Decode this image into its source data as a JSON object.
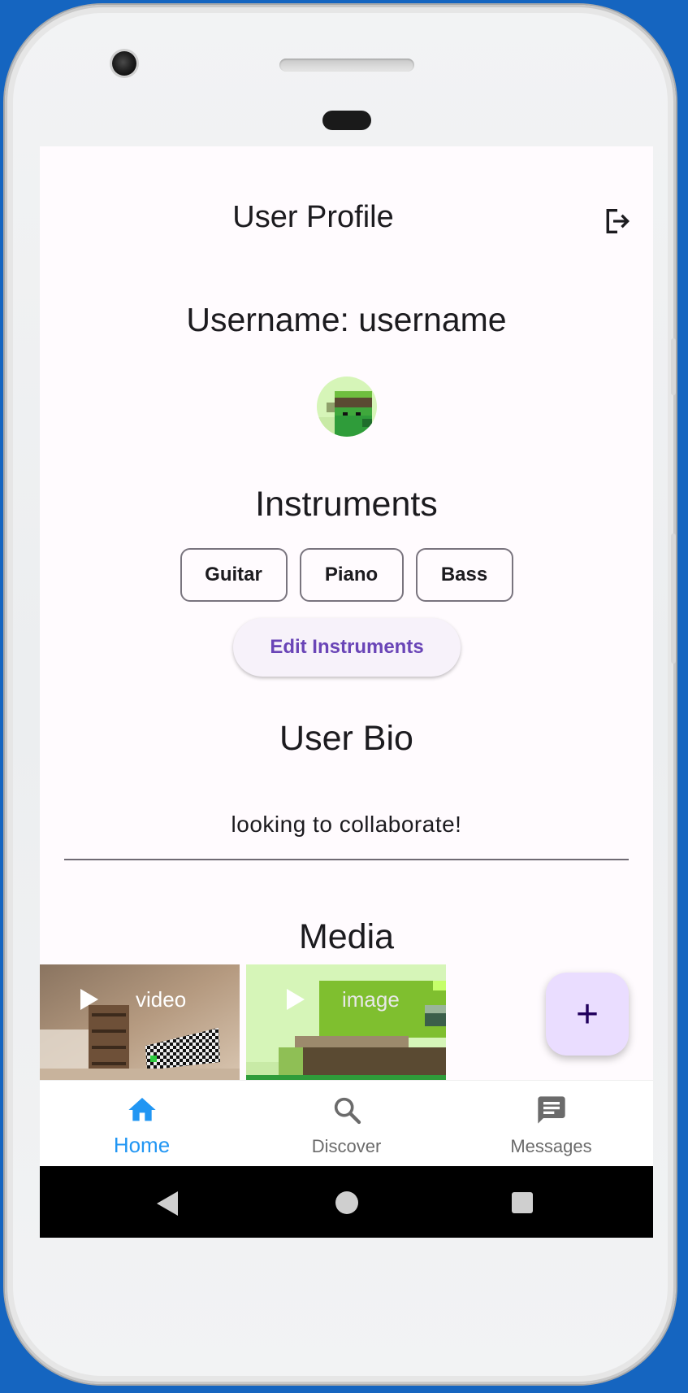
{
  "app_bar": {
    "title": "User Profile",
    "logout_icon": "logout-icon"
  },
  "profile": {
    "username_text": "Username: username",
    "avatar_icon": "pixel-avatar"
  },
  "instruments": {
    "heading": "Instruments",
    "chips": [
      "Guitar",
      "Piano",
      "Bass"
    ],
    "edit_button": "Edit Instruments"
  },
  "bio": {
    "heading": "User Bio",
    "text": "looking to collaborate!"
  },
  "media": {
    "heading": "Media",
    "items": [
      {
        "label": "video",
        "icon": "play-icon"
      },
      {
        "label": "image",
        "icon": "play-icon"
      }
    ],
    "add_button_icon": "plus-icon",
    "add_button_label": "+"
  },
  "bottom_nav": {
    "items": [
      {
        "label": "Home",
        "icon": "home-icon",
        "active": true
      },
      {
        "label": "Discover",
        "icon": "search-icon",
        "active": false
      },
      {
        "label": "Messages",
        "icon": "message-icon",
        "active": false
      }
    ]
  },
  "colors": {
    "accent": "#2196f3",
    "primary_purple": "#6a45b7",
    "fab_bg": "#eaddff",
    "surface": "#fffbfe"
  }
}
